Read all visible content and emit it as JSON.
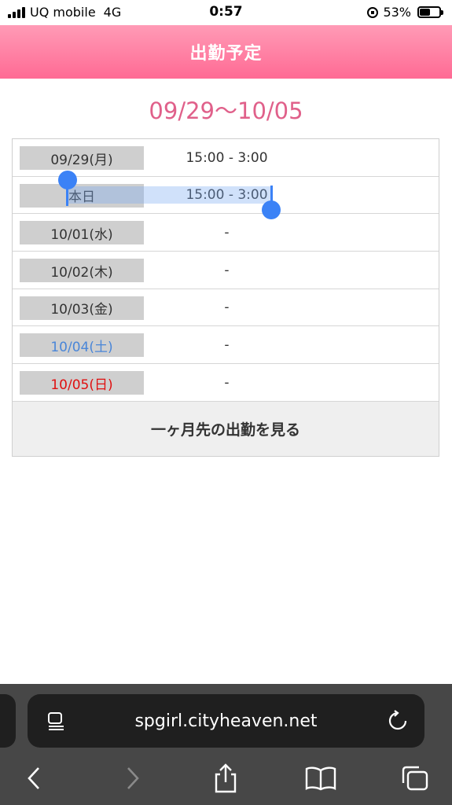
{
  "status_bar": {
    "carrier": "UQ mobile",
    "network": "4G",
    "time": "0:57",
    "battery_percent": "53%",
    "battery_level": 0.53
  },
  "header": {
    "title": "出勤予定"
  },
  "schedule": {
    "range_title": "09/29〜10/05",
    "rows": [
      {
        "day": "09/29(月)",
        "time": "15:00 - 3:00"
      },
      {
        "day": "本日",
        "time": "15:00 - 3:00"
      },
      {
        "day": "10/01(水)",
        "time": "-"
      },
      {
        "day": "10/02(木)",
        "time": "-"
      },
      {
        "day": "10/03(金)",
        "time": "-"
      },
      {
        "day": "10/04(土)",
        "time": "-"
      },
      {
        "day": "10/05(日)",
        "time": "-"
      }
    ],
    "more_button_label": "一ヶ月先の出勤を見る",
    "colors": {
      "saturday": "#4a86d8",
      "sunday": "#e01010",
      "title": "#e0608a",
      "header": "#ff7aa0"
    }
  },
  "browser": {
    "url": "spgirl.cityheaven.net",
    "icons": [
      "reader-icon",
      "reload-icon",
      "back-icon",
      "forward-icon",
      "share-icon",
      "bookmarks-icon",
      "tabs-icon"
    ]
  }
}
